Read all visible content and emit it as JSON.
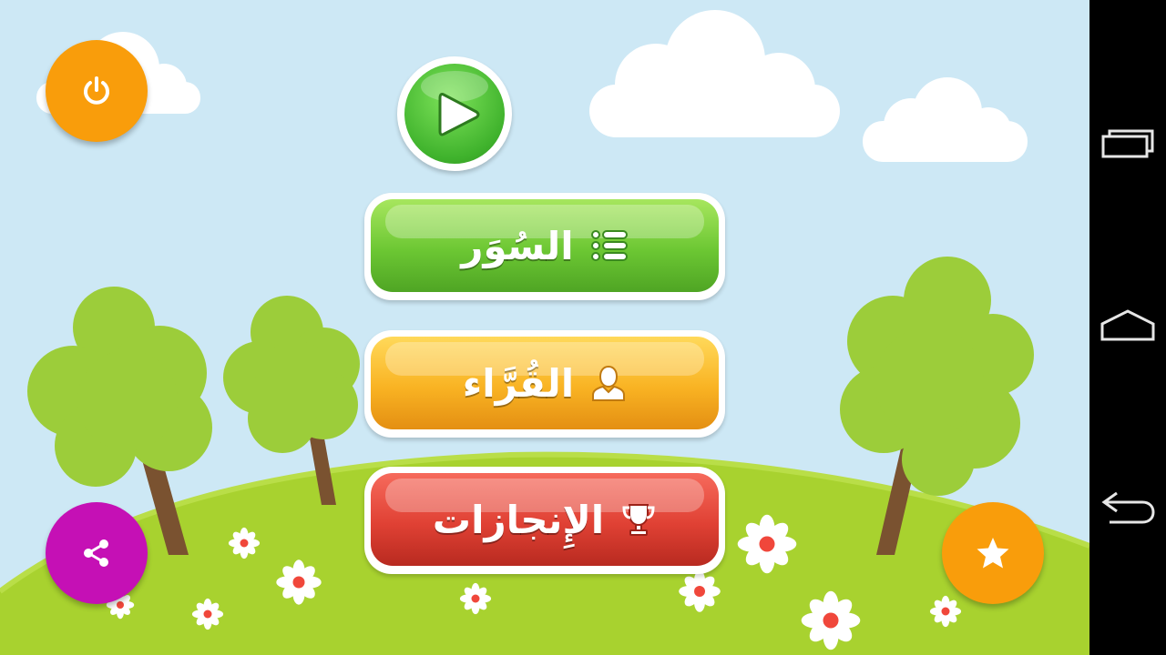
{
  "menu": {
    "surahs_label": "السُوَر",
    "reciters_label": "القُرَّاء",
    "achievements_label": "الإِنجازات"
  },
  "colors": {
    "sky": "#cde8f5",
    "hill": "#a8d22f",
    "green_button": "#6cc733",
    "yellow_button": "#f9b323",
    "red_button": "#e04134",
    "power_button": "#f99d0b",
    "share_button": "#c510b5",
    "star_button": "#f99d0b"
  },
  "icons": {
    "power": "power-icon",
    "play": "play-icon",
    "surahs": "list-icon",
    "reciters": "person-icon",
    "achievements": "trophy-icon",
    "share": "share-icon",
    "rate": "star-icon",
    "nav_recent": "recent-apps-icon",
    "nav_home": "home-icon",
    "nav_back": "back-icon"
  }
}
